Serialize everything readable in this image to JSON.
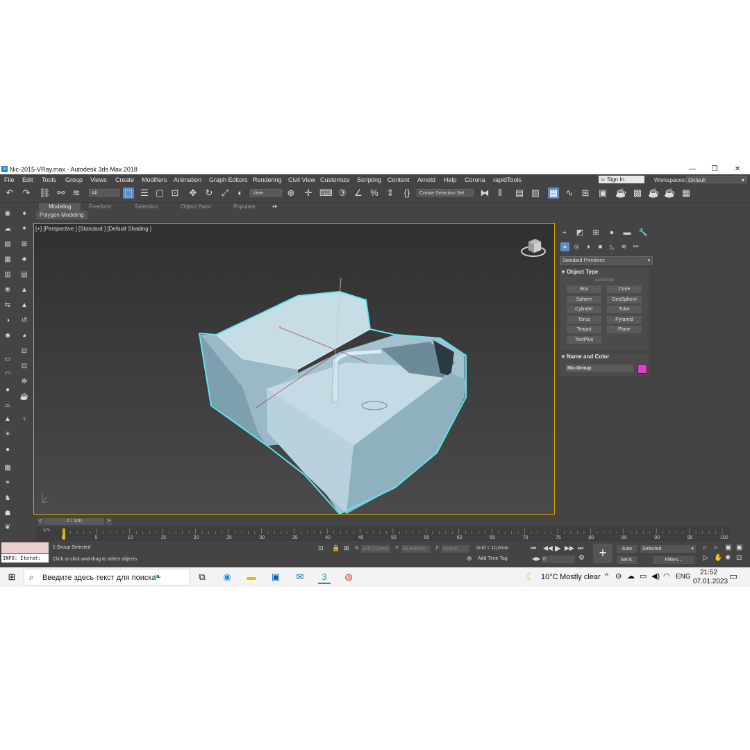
{
  "window": {
    "title": "Nic-2015-VRay.max - Autodesk 3ds Max 2018",
    "min": "—",
    "max": "❐",
    "close": "✕"
  },
  "menu": [
    "File",
    "Edit",
    "Tools",
    "Group",
    "Views",
    "Create",
    "Modifiers",
    "Animation",
    "Graph Editors",
    "Rendering",
    "Civil View",
    "Customize",
    "Scripting",
    "Content",
    "Arnold",
    "Help",
    "Corona",
    "rapidTools"
  ],
  "account": {
    "sign_in": "Sign In",
    "workspaces_label": "Workspaces:",
    "workspace": "Default"
  },
  "toolbar": {
    "filter": "All",
    "view": "View",
    "selection_set": "Create Selection Set"
  },
  "ribbon": {
    "tabs": [
      "Modeling",
      "Freeform",
      "Selection",
      "Object Paint",
      "Populate"
    ],
    "active": "Modeling",
    "sub": "Polygon Modeling"
  },
  "viewport": {
    "label": "[+] [Perspective ] [Standard ] [Default Shading ]"
  },
  "command_panel": {
    "category": "Standard Primitives",
    "object_type_title": "Object Type",
    "autogrid": "AutoGrid",
    "buttons": [
      "Box",
      "Cone",
      "Sphere",
      "GeoSphere",
      "Cylinder",
      "Tube",
      "Torus",
      "Pyramid",
      "Teapot",
      "Plane",
      "TextPlus"
    ],
    "name_color_title": "Name and Color",
    "object_name": "Nic-Group",
    "object_color": "#e040c8"
  },
  "timeline": {
    "frame": "0 / 100",
    "ticks": [
      "0",
      "5",
      "10",
      "15",
      "20",
      "25",
      "30",
      "35",
      "40",
      "45",
      "50",
      "55",
      "60",
      "65",
      "70",
      "75",
      "80",
      "85",
      "90",
      "95",
      "100"
    ]
  },
  "status": {
    "info": "INFO: Iterat:",
    "selected": "1 Group Selected",
    "prompt": "Click or click-and-drag to select objects",
    "x_label": "X:",
    "x": "140,712mm",
    "y_label": "Y:",
    "y": "89,448mm",
    "z_label": "Z:",
    "z": "0,0mm",
    "grid": "Grid = 10,0mm",
    "add_time_tag": "Add Time Tag",
    "auto": "Auto",
    "selected_filter": "Selected",
    "set_key": "Set K.",
    "filters": "Filters...",
    "frame_value": "0"
  },
  "taskbar": {
    "search": "Введите здесь текст для поиска",
    "weather_temp": "10°C",
    "weather_desc": "Mostly clear",
    "lang": "ENG",
    "time": "21:52",
    "date": "07.01.2023"
  }
}
